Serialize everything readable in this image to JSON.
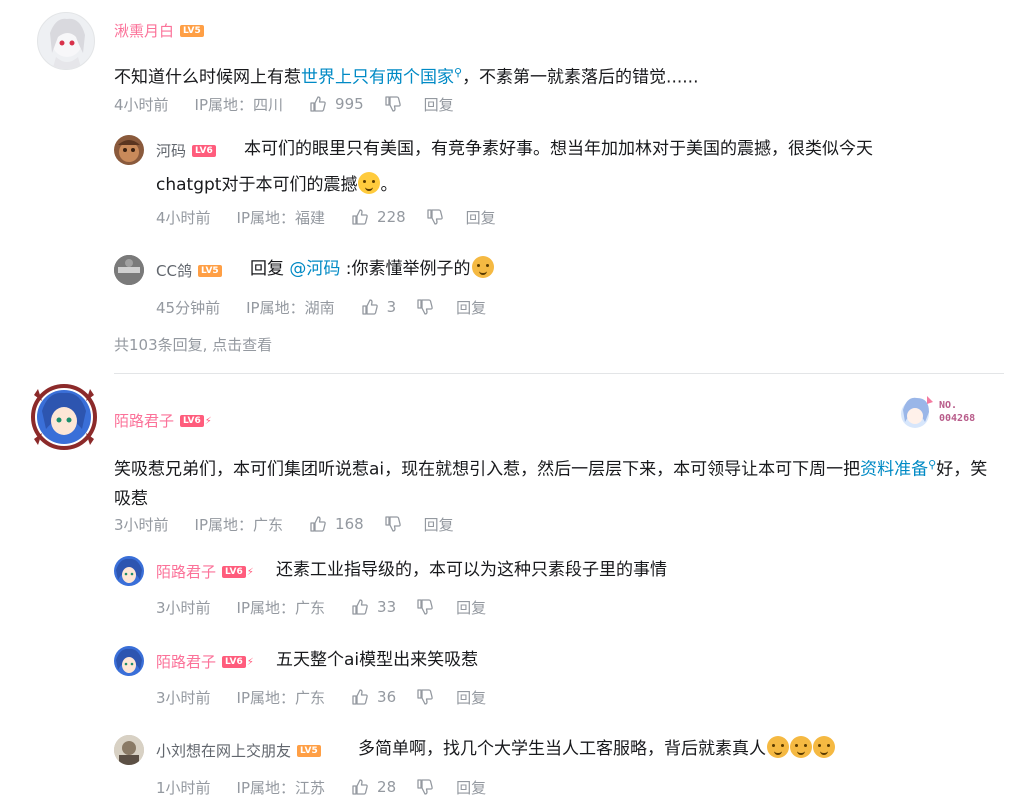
{
  "comments": [
    {
      "user": "湫熏月白",
      "level": "LV5",
      "text_before": "不知道什么时候网上有惹",
      "link": "世界上只有两个国家",
      "text_after": "，不素第一就素落后的错觉......",
      "time": "4小时前",
      "ip": "IP属地：四川",
      "likes": "995",
      "reply_label": "回复"
    },
    {
      "user": "陌路君子",
      "level": "LV6",
      "text_before": "笑吸惹兄弟们，本可们集团听说惹ai，现在就想引入惹，然后一层层下来，本可领导让本可下周一把",
      "link_part1": "资料准",
      "link_part2": "备",
      "text_after": "好，笑吸惹",
      "time": "3小时前",
      "ip": "IP属地：广东",
      "likes": "168",
      "reply_label": "回复",
      "badge_text": "NO.",
      "badge_number": "004268"
    }
  ],
  "replies1": [
    {
      "user": "河码",
      "level": "LV6",
      "line1": "本可们的眼里只有美国，有竞争素好事。想当年加加林对于美国的震撼，很类似今天",
      "line2": "chatgpt对于本可们的震撼",
      "line2_end": "。",
      "time": "4小时前",
      "ip": "IP属地：福建",
      "likes": "228",
      "reply_label": "回复"
    },
    {
      "user": "CC鸽",
      "level": "LV5",
      "prefix": "回复",
      "at": "@河码",
      "text": " :你素懂举例子的",
      "time": "45分钟前",
      "ip": "IP属地：湖南",
      "likes": "3",
      "reply_label": "回复"
    }
  ],
  "more_replies": "共103条回复, 点击查看",
  "replies2": [
    {
      "user": "陌路君子",
      "level": "LV6",
      "text": "还素工业指导级的，本可以为这种只素段子里的事情",
      "time": "3小时前",
      "ip": "IP属地：广东",
      "likes": "33",
      "reply_label": "回复"
    },
    {
      "user": "陌路君子",
      "level": "LV6",
      "text": "五天整个ai模型出来笑吸惹",
      "time": "3小时前",
      "ip": "IP属地：广东",
      "likes": "36",
      "reply_label": "回复"
    },
    {
      "user": "小刘想在网上交朋友",
      "level": "LV5",
      "text": "多简单啊，找几个大学生当人工客服略，背后就素真人",
      "time": "1小时前",
      "ip": "IP属地：江苏",
      "likes": "28",
      "reply_label": "回复"
    }
  ],
  "colors": {
    "username_pink": "#fb7299",
    "username_gray": "#61666d",
    "link_blue": "#008ac5",
    "meta_gray": "#9499a0",
    "lv5": "#ff9f45",
    "lv6": "#ff5c7c"
  }
}
